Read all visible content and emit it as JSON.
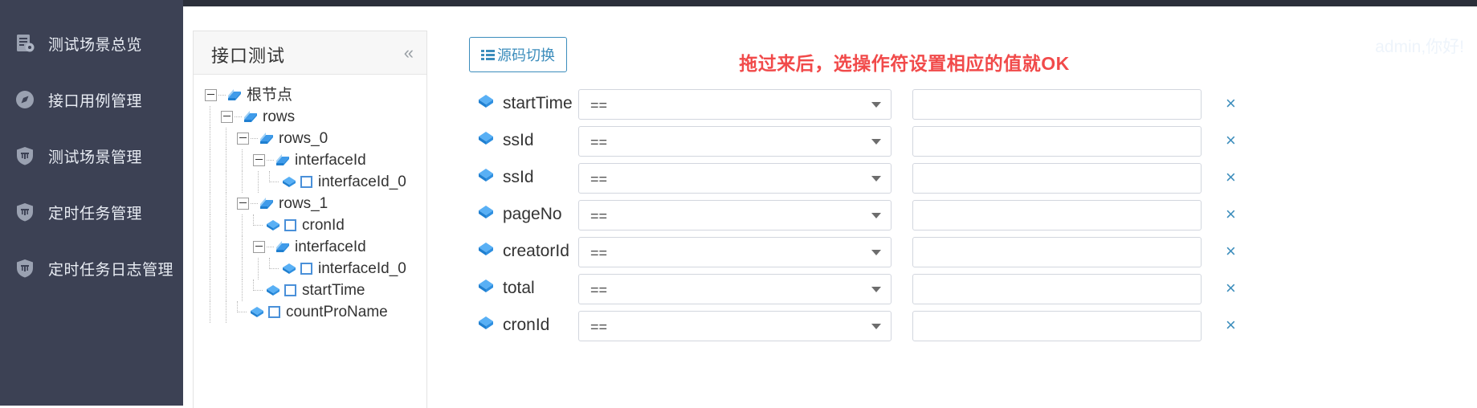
{
  "sidebar": {
    "items": [
      {
        "label": "测试场景总览",
        "icon": "report-icon"
      },
      {
        "label": "接口用例管理",
        "icon": "compass-icon"
      },
      {
        "label": "测试场景管理",
        "icon": "shield-icon"
      },
      {
        "label": "定时任务管理",
        "icon": "shield-icon"
      },
      {
        "label": "定时任务日志管理",
        "icon": "shield-icon"
      }
    ]
  },
  "tree_panel": {
    "title": "接口测试",
    "collapse_label": "«",
    "nodes": [
      {
        "label": "根节点",
        "depth": 0,
        "type": "folder",
        "expanded": true
      },
      {
        "label": "rows",
        "depth": 1,
        "type": "folder",
        "expanded": true
      },
      {
        "label": "rows_0",
        "depth": 2,
        "type": "folder",
        "expanded": true
      },
      {
        "label": "interfaceId",
        "depth": 3,
        "type": "folder",
        "expanded": true
      },
      {
        "label": "interfaceId_0",
        "depth": 4,
        "type": "leaf",
        "checked": false
      },
      {
        "label": "rows_1",
        "depth": 2,
        "type": "folder",
        "expanded": true
      },
      {
        "label": "cronId",
        "depth": 3,
        "type": "leaf",
        "checked": false
      },
      {
        "label": "interfaceId",
        "depth": 3,
        "type": "folder",
        "expanded": true
      },
      {
        "label": "interfaceId_0",
        "depth": 4,
        "type": "leaf",
        "checked": false
      },
      {
        "label": "startTime",
        "depth": 3,
        "type": "leaf",
        "checked": false
      },
      {
        "label": "countProName",
        "depth": 2,
        "type": "leaf",
        "checked": false
      }
    ]
  },
  "main": {
    "source_toggle_label": "源码切换",
    "hint": "拖过来后，选操作符设置相应的值就OK",
    "greeting": "admin,你好!",
    "delete_label": "×",
    "condition_rows": [
      {
        "field": "startTime",
        "operator": "==",
        "value": ""
      },
      {
        "field": "ssId",
        "operator": "==",
        "value": ""
      },
      {
        "field": "ssId",
        "operator": "==",
        "value": ""
      },
      {
        "field": "pageNo",
        "operator": "==",
        "value": ""
      },
      {
        "field": "creatorId",
        "operator": "==",
        "value": ""
      },
      {
        "field": "total",
        "operator": "==",
        "value": ""
      },
      {
        "field": "cronId",
        "operator": "==",
        "value": ""
      }
    ]
  },
  "colors": {
    "sidebar_bg": "#3c4154",
    "accent": "#3c8dbc",
    "hint_red": "#f14a4a",
    "tree_node_blue": "#2e8fe0"
  }
}
